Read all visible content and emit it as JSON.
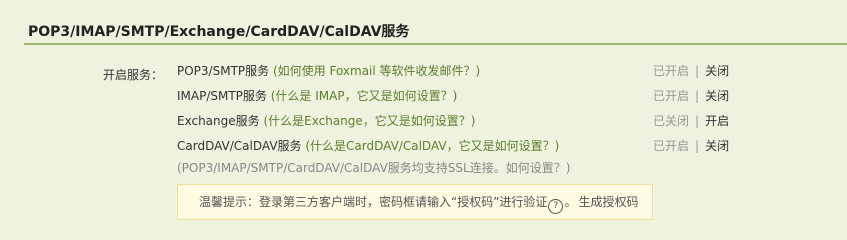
{
  "section": {
    "title": "POP3/IMAP/SMTP/Exchange/CardDAV/CalDAV服务"
  },
  "label": "开启服务：",
  "services": [
    {
      "name": "POP3/SMTP服务",
      "help": "(如何使用 Foxmail 等软件收发邮件？)",
      "current": "已开启",
      "action": "关闭"
    },
    {
      "name": "IMAP/SMTP服务",
      "help": "(什么是 IMAP，它又是如何设置？)",
      "current": "已开启",
      "action": "关闭"
    },
    {
      "name": "Exchange服务",
      "help": "(什么是Exchange，它又是如何设置？)",
      "current": "已关闭",
      "action": "开启"
    },
    {
      "name": "CardDAV/CalDAV服务",
      "help": "(什么是CardDAV/CalDAV，它又是如何设置？)",
      "current": "已开启",
      "action": "关闭"
    }
  ],
  "separator": "|",
  "ssl_note": "(POP3/IMAP/SMTP/CardDAV/CalDAV服务均支持SSL连接。如何设置？)",
  "tip": {
    "text": "温馨提示：登录第三方客户端时，密码框请输入“授权码”进行验证",
    "icon": "question-circle-icon",
    "icon_glyph": "?",
    "suffix": "。",
    "link": "生成授权码"
  },
  "colors": {
    "background": "#eef2df",
    "rule": "#9cb56a",
    "help_link": "#5e7d2e",
    "tip_bg": "#fffbe3",
    "tip_border": "#f1dd9a"
  }
}
